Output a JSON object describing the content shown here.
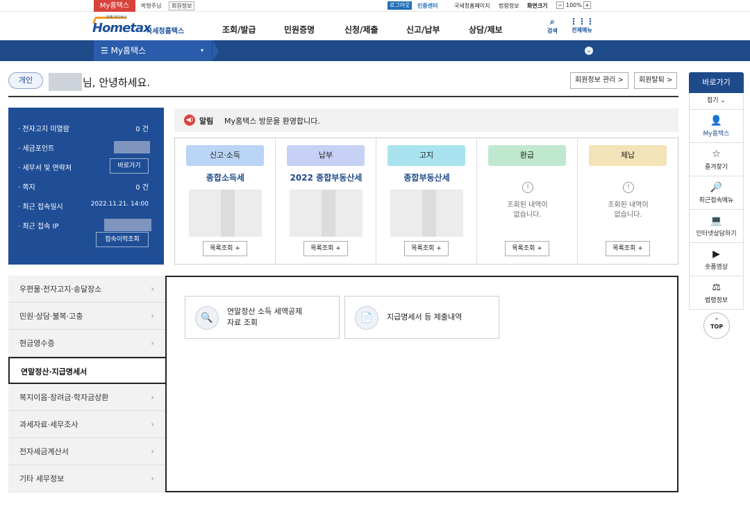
{
  "topbar": {
    "my_hometax": "My홈택스",
    "user_name": "박형주님",
    "member_info": "회원정보",
    "logout": "로그아웃",
    "cert_center": "인증센터",
    "nts_home": "국세청홈페이지",
    "org_info": "법령정보",
    "zoom_label": "화면크기",
    "zoom_minus": "−",
    "zoom_value": "100%",
    "zoom_plus": "+"
  },
  "header": {
    "logo_main": "Hometax",
    "logo_kor": "국세청홈택스",
    "logo_tag": "언제 어디서나",
    "menu": [
      "조회/발급",
      "민원증명",
      "신청/제출",
      "신고/납부",
      "상담/제보"
    ],
    "search": "검색",
    "all_menu": "전체메뉴"
  },
  "navbar": {
    "my_hometax": "My홈택스",
    "caret": "▾",
    "down": "⌄"
  },
  "greeting": {
    "badge": "개인",
    "text": "님, 안녕하세요.",
    "member_mgmt": "회원정보 관리 >",
    "withdraw": "회원탈퇴 >"
  },
  "info": {
    "items": [
      {
        "label": "· 전자고지 미열람",
        "value": "0 건"
      },
      {
        "label": "· 세금포인트",
        "value": ""
      },
      {
        "label": "· 세무서 및 연락처",
        "value": ""
      },
      {
        "label": "· 쪽지",
        "value": "0 건"
      },
      {
        "label": "· 최근 접속일시",
        "value": "2022.11.21. 14:00"
      },
      {
        "label": "· 최근 접속 IP",
        "value": ""
      }
    ],
    "shortcut_btn": "바로가기",
    "history_btn": "접속이력조회"
  },
  "alert": {
    "icon": "◀)",
    "label": "알림",
    "text": "My홈택스 방문을 환영합니다."
  },
  "cards": [
    {
      "pill": "신고·소득",
      "title": "종합소득세",
      "button": "목록조회 +",
      "color": "#b9d4f5"
    },
    {
      "pill": "납부",
      "title": "2022 종합부동산세",
      "button": "목록조회 +",
      "color": "#c7d0f5"
    },
    {
      "pill": "고지",
      "title": "종합부동산세",
      "button": "목록조회 +",
      "color": "#a8e3ef"
    },
    {
      "pill": "환급",
      "empty": "조회된 내역이\n없습니다.",
      "button": "목록조회 +",
      "color": "#bfe8cf"
    },
    {
      "pill": "체납",
      "empty": "조회된 내역이\n없습니다.",
      "button": "목록조회 +",
      "color": "#f3e3b8"
    }
  ],
  "left_menu": [
    {
      "label": "우편물·전자고지·송달장소",
      "chev": "›"
    },
    {
      "label": "민원·상담·불복·고충",
      "chev": "›"
    },
    {
      "label": "현금영수증",
      "chev": "›"
    },
    {
      "label": "연말정산·지급명세서",
      "chev": ""
    },
    {
      "label": "복지이음·장려금·학자금상환",
      "chev": "›"
    },
    {
      "label": "과세자료·세무조사",
      "chev": "›"
    },
    {
      "label": "전자세금계산서",
      "chev": "›"
    },
    {
      "label": "기타 세무정보",
      "chev": "›"
    }
  ],
  "main_buttons": [
    {
      "icon": "🔍",
      "line1": "연말정산 소득 세액공제",
      "line2": "자료 조회"
    },
    {
      "icon": "📄",
      "line1": "지급명세서 등 제출내역",
      "line2": ""
    }
  ],
  "quick": {
    "title": "바로가기",
    "fold": "접기 ⌄",
    "items": [
      {
        "icon": "👤",
        "label": "My홈택스"
      },
      {
        "icon": "☆",
        "label": "즐겨찾기"
      },
      {
        "icon": "🔎",
        "label": "최근접속메뉴"
      },
      {
        "icon": "💻",
        "label": "인터넷상담하기"
      },
      {
        "icon": "▶",
        "label": "숏폼영상"
      },
      {
        "icon": "⚖",
        "label": "법령정보"
      }
    ],
    "top_arrow": "⌃",
    "top": "TOP"
  }
}
